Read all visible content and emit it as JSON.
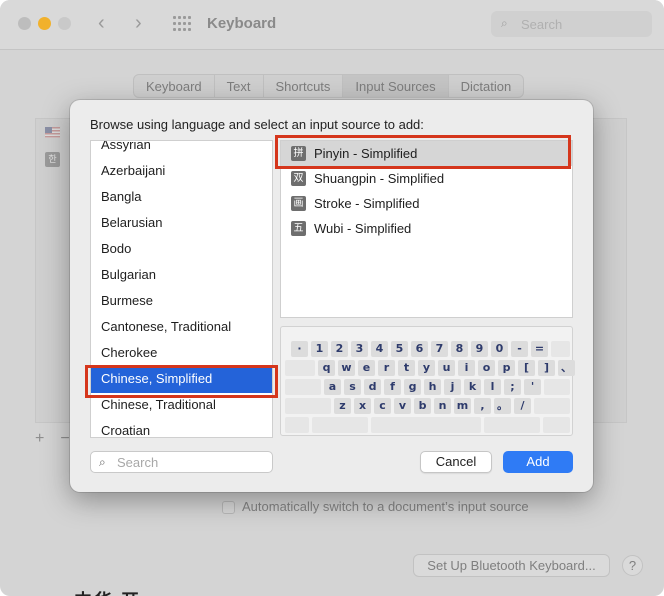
{
  "window": {
    "title": "Keyboard",
    "search_placeholder": "Search",
    "tabs": [
      {
        "label": "Keyboard"
      },
      {
        "label": "Text"
      },
      {
        "label": "Shortcuts"
      },
      {
        "label": "Input Sources",
        "selected": true
      },
      {
        "label": "Dictation"
      }
    ],
    "auto_switch_label": "Automatically switch to a document’s input source",
    "auto_switch_checked": false,
    "bluetooth_button_label": "Set Up Bluetooth Keyboard...",
    "help_label": "?",
    "plus_label": "+",
    "minus_label": "−",
    "flag_icon_glyph": "한",
    "partial_bottom_text": "中华 开"
  },
  "sheet": {
    "prompt": "Browse using language and select an input source to add:",
    "languages": [
      "Assyrian",
      "Azerbaijani",
      "Bangla",
      "Belarusian",
      "Bodo",
      "Bulgarian",
      "Burmese",
      "Cantonese, Traditional",
      "Cherokee",
      "Chinese, Simplified",
      "Chinese, Traditional",
      "Croatian"
    ],
    "selected_language": "Chinese, Simplified",
    "input_sources": [
      {
        "icon_glyph": "拼",
        "label": "Pinyin - Simplified"
      },
      {
        "icon_glyph": "双",
        "label": "Shuangpin - Simplified"
      },
      {
        "icon_glyph": "画",
        "label": "Stroke - Simplified"
      },
      {
        "icon_glyph": "五",
        "label": "Wubi - Simplified"
      }
    ],
    "selected_source": "Pinyin - Simplified",
    "keyboard_rows": [
      [
        "·",
        "1",
        "2",
        "3",
        "4",
        "5",
        "6",
        "7",
        "8",
        "9",
        "0",
        "-",
        "="
      ],
      [
        "q",
        "w",
        "e",
        "r",
        "t",
        "y",
        "u",
        "i",
        "o",
        "p",
        "[",
        "]",
        "、"
      ],
      [
        "a",
        "s",
        "d",
        "f",
        "g",
        "h",
        "j",
        "k",
        "l",
        ";",
        "'"
      ],
      [
        "z",
        "x",
        "c",
        "v",
        "b",
        "n",
        "m",
        ",",
        "。",
        "/"
      ]
    ],
    "search_placeholder": "Search",
    "search_value": "",
    "cancel_label": "Cancel",
    "add_label": "Add"
  },
  "colors": {
    "accent": "#2f7bf5",
    "selection": "#2463d9",
    "highlight_box": "#d5361c",
    "key_text": "#2e3b6c"
  },
  "icons": {
    "search": "magnifier-icon",
    "back": "chevron-left-icon",
    "forward": "chevron-right-icon",
    "grid": "grid-icon"
  }
}
